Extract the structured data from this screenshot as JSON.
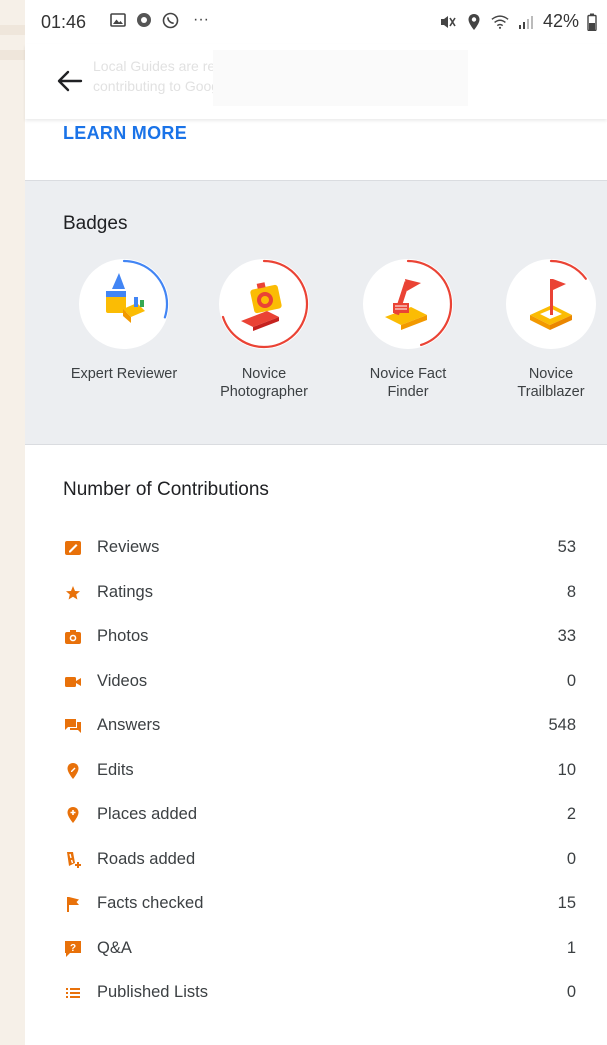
{
  "status_bar": {
    "time": "01:46",
    "left_icons": [
      "gallery-icon",
      "messenger-icon",
      "whatsapp-icon",
      "more-dots-icon"
    ],
    "more": "···",
    "battery": "42%",
    "right_icons": [
      "mute-icon",
      "location-icon",
      "wifi-icon",
      "signal-icon",
      "battery-icon"
    ]
  },
  "appbar": {
    "back_icon": "arrow-back-icon",
    "faded_text_line1": "Local Guides are rewarded with points and badges for",
    "faded_text_line2": "contributing to Google Maps"
  },
  "learn_more": "LEARN MORE",
  "badges": {
    "title": "Badges",
    "items": [
      {
        "label_line1": "Expert Reviewer",
        "label_line2": "",
        "icon": "expert-reviewer-icon",
        "progress": 0.3,
        "ring_color": "#4285f4"
      },
      {
        "label_line1": "Novice",
        "label_line2": "Photographer",
        "icon": "photographer-icon",
        "progress": 0.7,
        "ring_color": "#ea4335"
      },
      {
        "label_line1": "Novice Fact",
        "label_line2": "Finder",
        "icon": "fact-finder-icon",
        "progress": 0.45,
        "ring_color": "#ea4335"
      },
      {
        "label_line1": "Novice",
        "label_line2": "Trailblazer",
        "icon": "trailblazer-icon",
        "progress": 0.15,
        "ring_color": "#ea4335"
      }
    ]
  },
  "contributions": {
    "title": "Number of Contributions",
    "accent": "#e8710a",
    "items": [
      {
        "label": "Reviews",
        "value": "53",
        "icon": "review-icon"
      },
      {
        "label": "Ratings",
        "value": "8",
        "icon": "star-icon"
      },
      {
        "label": "Photos",
        "value": "33",
        "icon": "camera-icon"
      },
      {
        "label": "Videos",
        "value": "0",
        "icon": "video-icon"
      },
      {
        "label": "Answers",
        "value": "548",
        "icon": "answers-icon"
      },
      {
        "label": "Edits",
        "value": "10",
        "icon": "edit-pin-icon"
      },
      {
        "label": "Places added",
        "value": "2",
        "icon": "add-place-icon"
      },
      {
        "label": "Roads added",
        "value": "0",
        "icon": "add-road-icon"
      },
      {
        "label": "Facts checked",
        "value": "15",
        "icon": "flag-icon"
      },
      {
        "label": "Q&A",
        "value": "1",
        "icon": "question-icon"
      },
      {
        "label": "Published Lists",
        "value": "0",
        "icon": "list-icon"
      }
    ]
  }
}
